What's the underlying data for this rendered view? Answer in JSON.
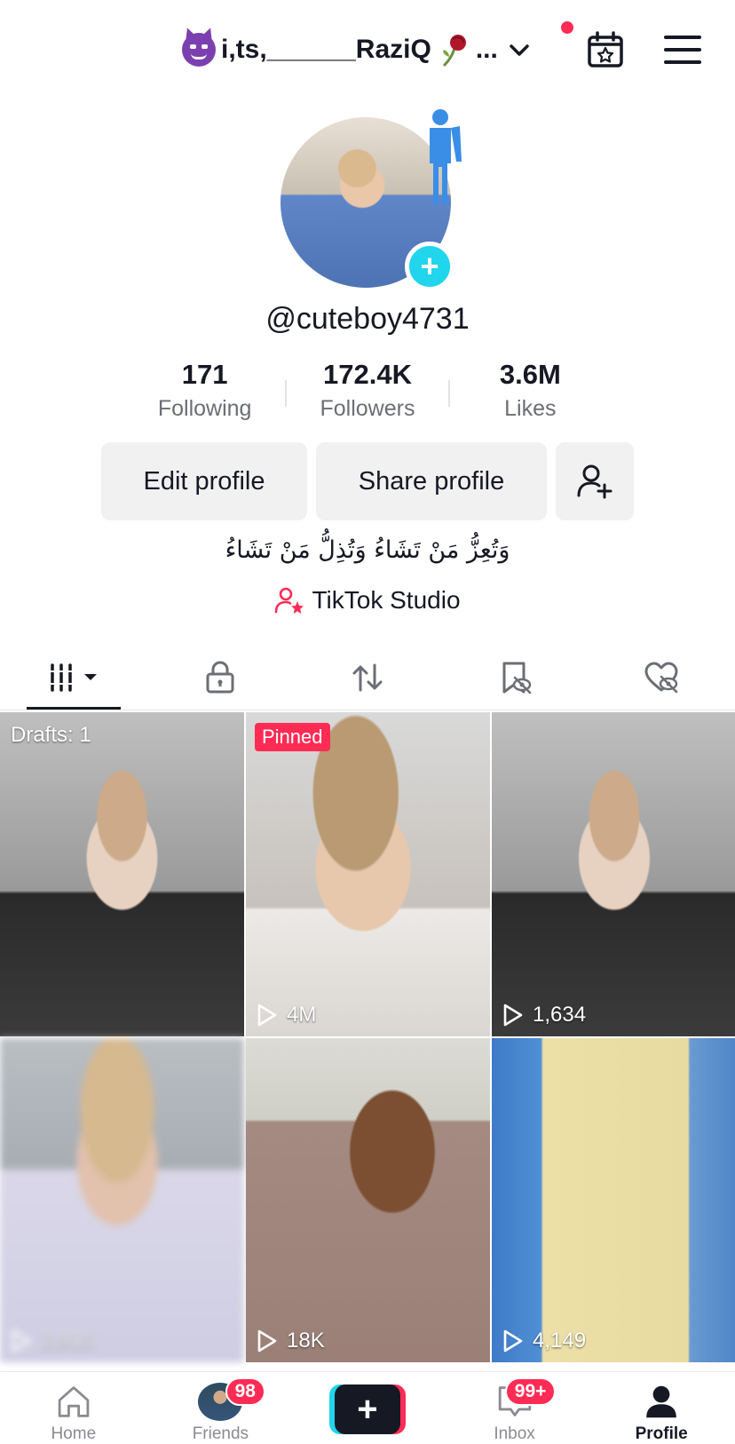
{
  "header": {
    "display_name": "i,ts,______RaziQ",
    "ellipsis": "...",
    "has_notification_dot": true
  },
  "profile": {
    "username": "@cuteboy4731",
    "avatar_add": "+",
    "stats": [
      {
        "value": "171",
        "label": "Following"
      },
      {
        "value": "172.4K",
        "label": "Followers"
      },
      {
        "value": "3.6M",
        "label": "Likes"
      }
    ],
    "buttons": {
      "edit": "Edit profile",
      "share": "Share profile"
    },
    "bio": "وَتُعِزُّ مَنْ تَشَاءُ وَتُذِلُّ مَنْ تَشَاءُ",
    "studio_label": "TikTok Studio"
  },
  "tabs": [
    {
      "name": "videos",
      "icon": "grid-icon",
      "active": true
    },
    {
      "name": "private",
      "icon": "lock-icon",
      "active": false
    },
    {
      "name": "reposts",
      "icon": "repost-icon",
      "active": false
    },
    {
      "name": "favorites",
      "icon": "bookmark-hidden-icon",
      "active": false
    },
    {
      "name": "liked",
      "icon": "heart-hidden-icon",
      "active": false
    }
  ],
  "videos": [
    {
      "label": "Drafts: 1",
      "views": ""
    },
    {
      "label": "Pinned",
      "views": "4M"
    },
    {
      "label": "",
      "views": "1,634"
    },
    {
      "label": "",
      "views": "2,915"
    },
    {
      "label": "",
      "views": "18K"
    },
    {
      "label": "",
      "views": "4,149"
    }
  ],
  "bottom_nav": {
    "home": "Home",
    "friends": "Friends",
    "friends_badge": "98",
    "create": "+",
    "inbox": "Inbox",
    "inbox_badge": "99+",
    "profile": "Profile"
  },
  "colors": {
    "accent_red": "#fe2c55",
    "accent_cyan": "#20d5ec",
    "text_primary": "#161823",
    "text_secondary": "#6b6e74",
    "button_bg": "#f1f1f2"
  }
}
